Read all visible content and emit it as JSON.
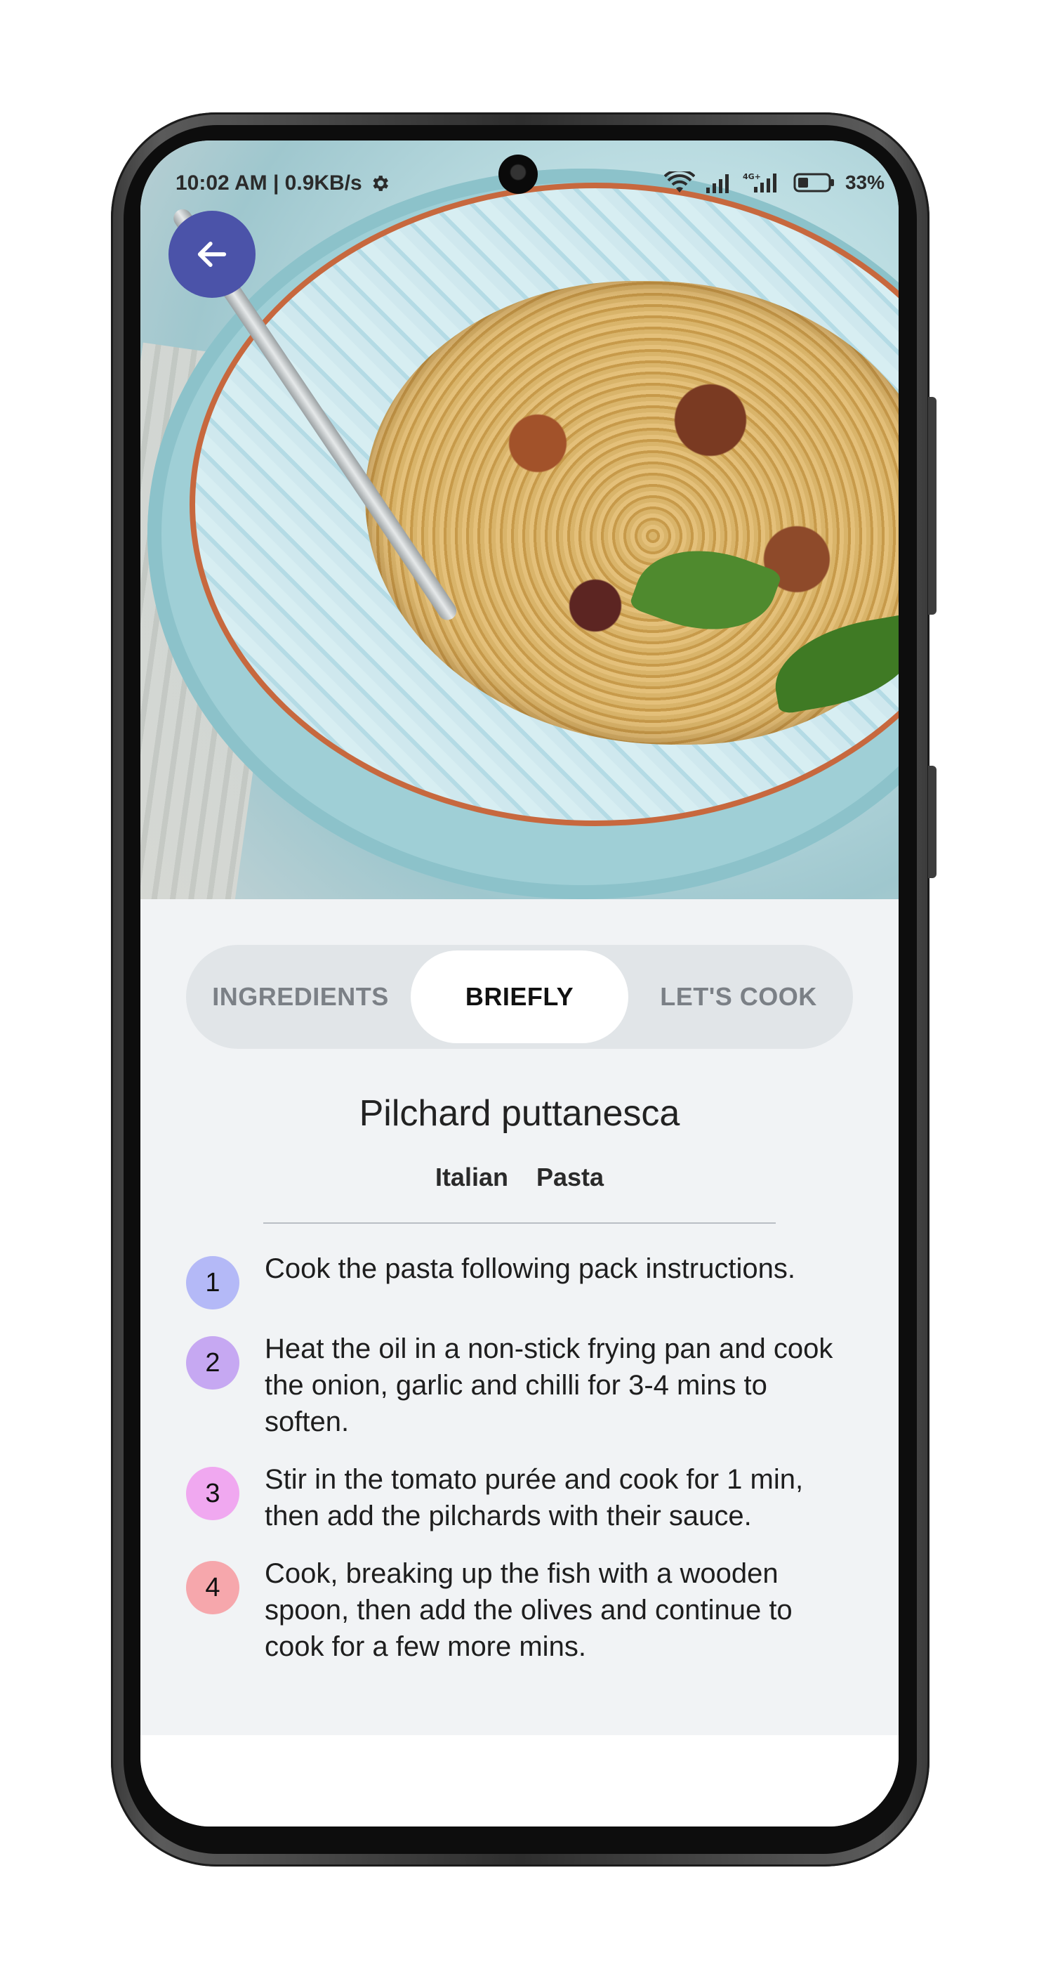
{
  "status_bar": {
    "time": "10:02 AM | 0.9KB/s",
    "battery": "33%"
  },
  "icons": {
    "back": "arrow-left-icon",
    "settings": "gear-icon",
    "wifi": "wifi-icon",
    "signal": "signal-icon",
    "signal_4g": "signal-4g-icon",
    "battery": "battery-icon"
  },
  "colors": {
    "back_button": "#4b53a9",
    "tab_active_bg": "#ffffff",
    "tab_track_bg": "#e1e5e8",
    "step_1": "#b4b9f7",
    "step_2": "#c6a8f2",
    "step_3": "#f0a8f0",
    "step_4": "#f6a7ac"
  },
  "tabs": [
    {
      "label": "INGREDIENTS",
      "active": false
    },
    {
      "label": "BRIEFLY",
      "active": true
    },
    {
      "label": "LET'S COOK",
      "active": false
    }
  ],
  "recipe": {
    "title": "Pilchard puttanesca",
    "tags": [
      "Italian",
      "Pasta"
    ],
    "steps": [
      {
        "number": "1",
        "text": "Cook the pasta following pack instructions."
      },
      {
        "number": "2",
        "text": "Heat the oil in a non-stick frying pan and cook the onion, garlic and chilli for 3-4 mins to soften."
      },
      {
        "number": "3",
        "text": "Stir in the tomato purée and cook for 1 min, then add the pilchards with their sauce."
      },
      {
        "number": "4",
        "text": "Cook, breaking up the fish with a wooden spoon, then add the olives and continue to cook for a few more mins."
      }
    ]
  }
}
